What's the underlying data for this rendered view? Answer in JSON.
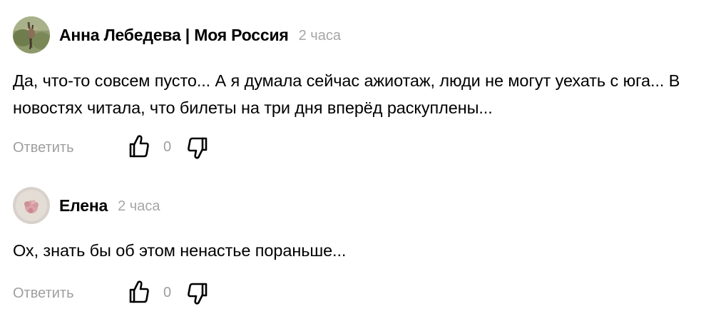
{
  "comments": [
    {
      "author": "Анна Лебедева | Моя Россия",
      "time": "2 часа",
      "text": "Да, что-то совсем пусто... А я думала сейчас ажиотаж, люди не могут уехать с юга... В новостях читала, что билеты на три дня вперёд раскуплены...",
      "reply_label": "Ответить",
      "likes": "0",
      "avatar_icon": "plant-photo-avatar",
      "like_icon": "thumbs-up-icon",
      "dislike_icon": "thumbs-down-icon"
    },
    {
      "author": "Елена",
      "time": "2 часа",
      "text": "Ох, знать бы об этом ненастье пораньше...",
      "reply_label": "Ответить",
      "likes": "0",
      "avatar_icon": "flower-photo-avatar",
      "like_icon": "thumbs-up-icon",
      "dislike_icon": "thumbs-down-icon"
    }
  ],
  "colors": {
    "text": "#000000",
    "muted": "#9e9e9e",
    "time": "#a6a6a6"
  }
}
